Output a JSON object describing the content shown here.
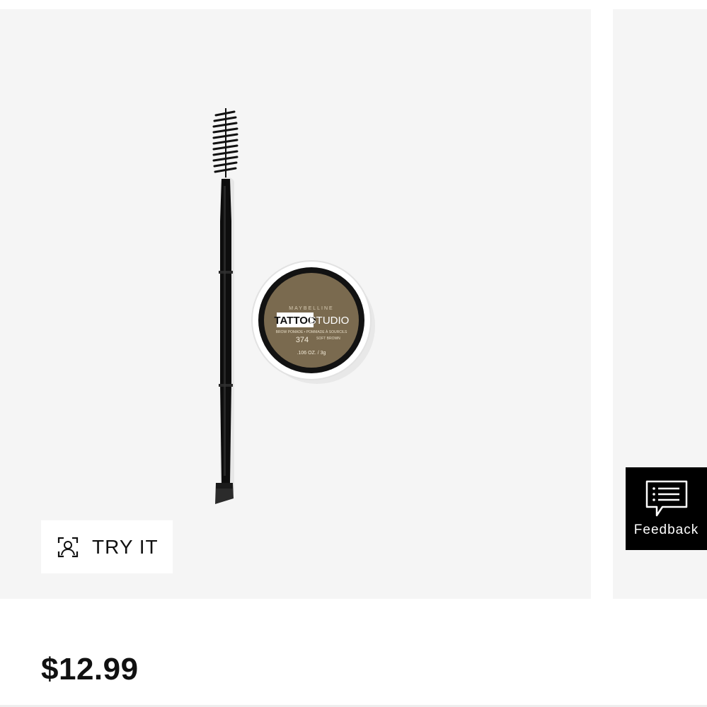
{
  "product": {
    "brand_on_package": "MAYBELLINE",
    "package_title_1": "TATTOO",
    "package_title_2": "STUDIO",
    "package_subtitle": "BROW POMADE • POMMADE À SOURCILS",
    "shade_number": "374",
    "shade_name": "SOFT BROWN",
    "net_weight": ".106 OZ. / 3g",
    "price": "$12.99"
  },
  "try_it": {
    "label": "TRY IT",
    "icon": "face-scan-icon"
  },
  "feedback": {
    "label": "Feedback",
    "icon": "comment-list-icon"
  },
  "colors": {
    "slide_background": "#f5f5f5",
    "pomade_shade": "#7a6a4f",
    "feedback_background": "#000000"
  }
}
